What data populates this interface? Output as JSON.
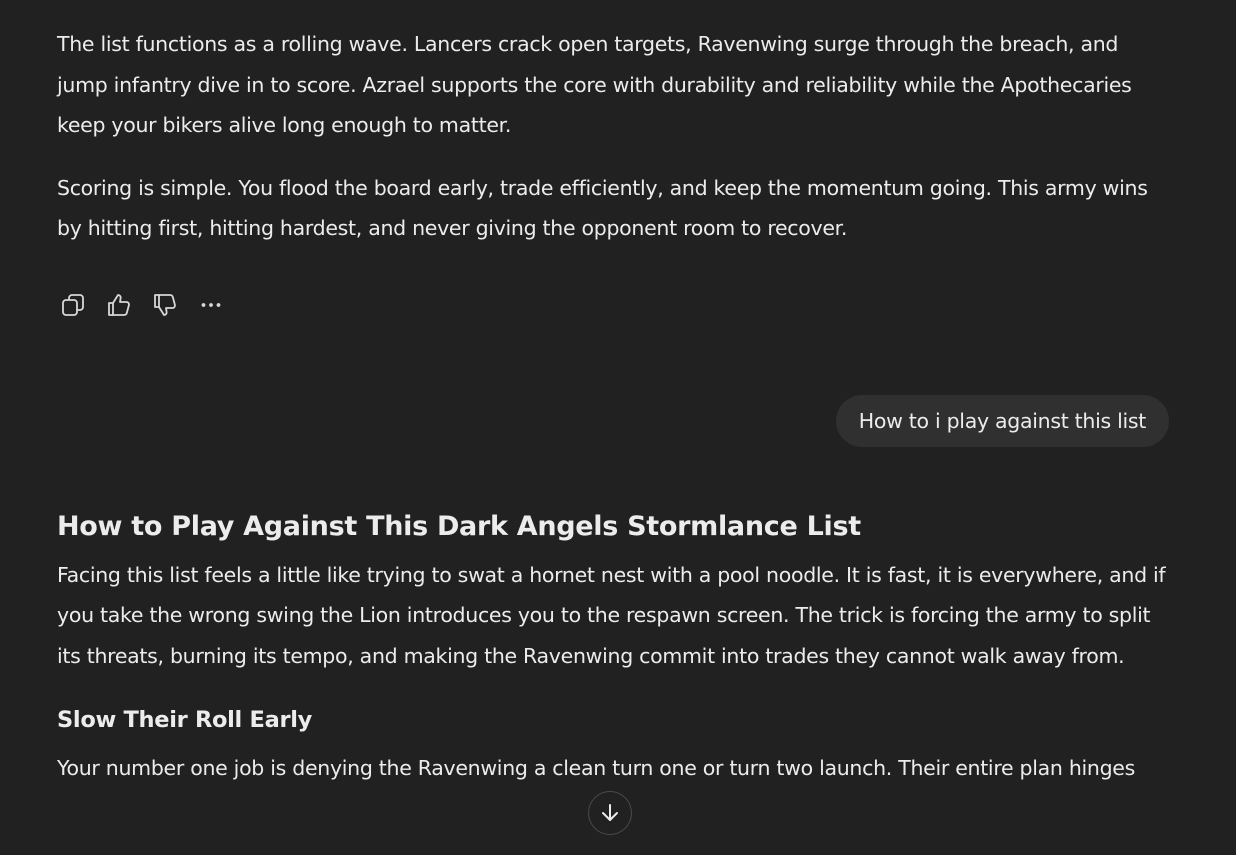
{
  "assistant_previous": {
    "paragraphs": [
      "The list functions as a rolling wave. Lancers crack open targets, Ravenwing surge through the breach, and jump infantry dive in to score. Azrael supports the core with durability and reliability while the Apothecaries keep your bikers alive long enough to matter.",
      "Scoring is simple. You flood the board early, trade efficiently, and keep the momentum going. This army wins by hitting first, hitting hardest, and never giving the opponent room to recover."
    ]
  },
  "message_actions": {
    "icons": [
      "copy-icon",
      "thumbs-up-icon",
      "thumbs-down-icon",
      "more-icon"
    ]
  },
  "user_message": {
    "text": "How to i play against this list"
  },
  "assistant_reply": {
    "heading": "How to Play Against This Dark Angels Stormlance List",
    "intro": "Facing this list feels a little like trying to swat a hornet nest with a pool noodle. It is fast, it is everywhere, and if you take the wrong swing the Lion introduces you to the respawn screen. The trick is forcing the army to split its threats, burning its tempo, and making the Ravenwing commit into trades they cannot walk away from.",
    "subheading": "Slow Their Roll Early",
    "section_text": "Your number one job is denying the Ravenwing a clean turn one or turn two launch. Their entire plan hinges"
  },
  "scroll_button": {
    "icon": "arrow-down-icon"
  },
  "colors": {
    "background": "#212121",
    "text": "#ececec",
    "user_bubble": "#303030"
  }
}
